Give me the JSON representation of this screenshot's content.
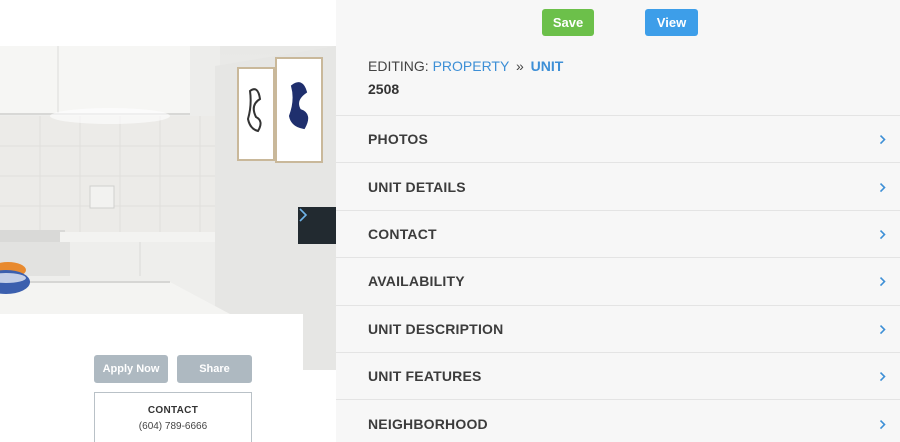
{
  "toolbar": {
    "save_label": "Save",
    "view_label": "View"
  },
  "breadcrumb": {
    "prefix": "EDITING:",
    "property": "PROPERTY",
    "separator": "»",
    "unit": "UNIT"
  },
  "unit_number": "2508",
  "sections": [
    {
      "label": "PHOTOS"
    },
    {
      "label": "UNIT DETAILS"
    },
    {
      "label": "CONTACT"
    },
    {
      "label": "AVAILABILITY"
    },
    {
      "label": "UNIT DESCRIPTION"
    },
    {
      "label": "UNIT FEATURES"
    },
    {
      "label": "NEIGHBORHOOD"
    }
  ],
  "preview": {
    "apply_label": "Apply Now",
    "share_label": "Share",
    "contact_title": "CONTACT",
    "contact_phone": "(604) 789-6666"
  },
  "colors": {
    "save": "#6cc04a",
    "view": "#3d9ee9",
    "link": "#3d8fd6",
    "panel_bg": "#f7f7f7"
  },
  "icons": {
    "next": "chevron-right-icon",
    "section": "chevron-right-icon"
  }
}
